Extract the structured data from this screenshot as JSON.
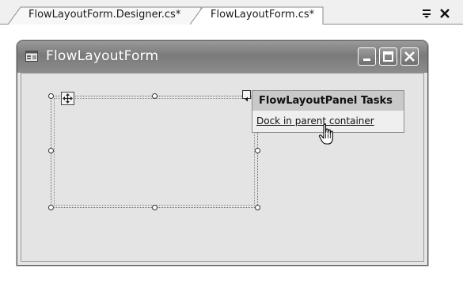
{
  "tabs": [
    {
      "label": "FlowLayoutForm.Designer.cs*"
    },
    {
      "label": "FlowLayoutForm.cs*"
    }
  ],
  "tabstrip": {
    "pin_icon": "pin-icon",
    "close_icon": "close-icon"
  },
  "form": {
    "title": "FlowLayoutForm",
    "icon": "form-icon",
    "caption_buttons": [
      "minimize-icon",
      "maximize-icon",
      "close-icon"
    ]
  },
  "smart_tag_panel": {
    "header": "FlowLayoutPanel Tasks",
    "link": "Dock in parent container"
  },
  "colors": {
    "titlebar": "#8a8a8a",
    "client": "#e4e4e4",
    "tasks_header": "#c9c9c9"
  }
}
